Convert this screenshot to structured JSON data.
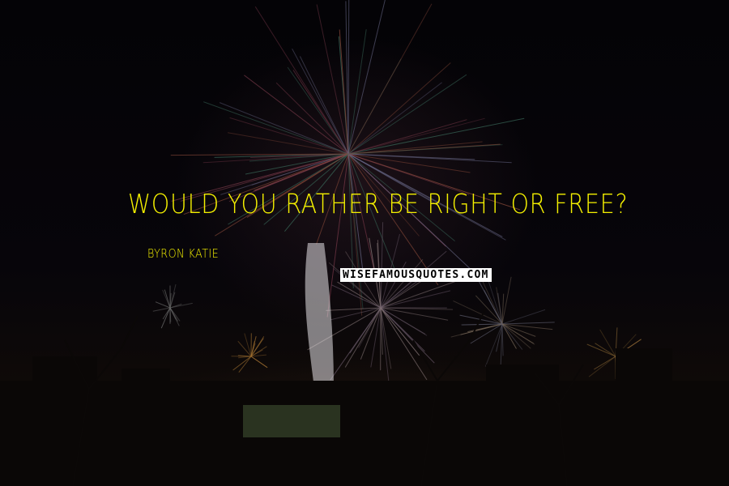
{
  "quote": {
    "text": "Would you rather be right or free?",
    "author": "Byron Katie"
  },
  "watermark": {
    "text": "WISEFAMOUSQUOTES.COM"
  },
  "colors": {
    "quote_text": "#f4f000",
    "background": "#050407"
  }
}
